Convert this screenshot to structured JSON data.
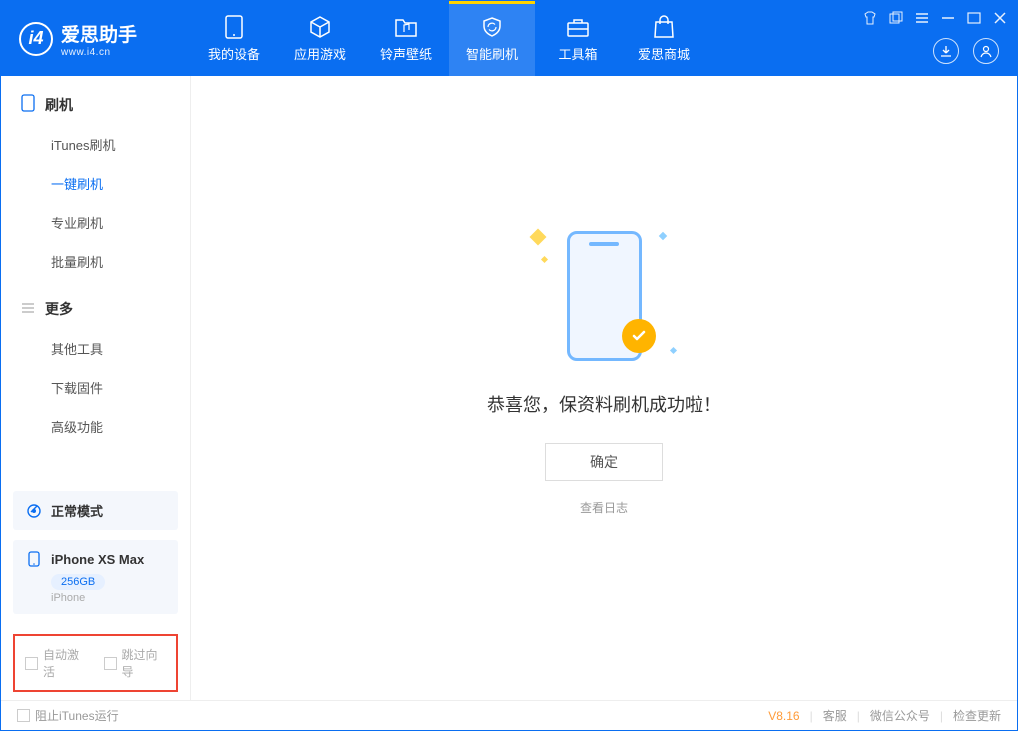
{
  "app": {
    "name": "爱思助手",
    "url": "www.i4.cn"
  },
  "nav": {
    "items": [
      {
        "label": "我的设备"
      },
      {
        "label": "应用游戏"
      },
      {
        "label": "铃声壁纸"
      },
      {
        "label": "智能刷机"
      },
      {
        "label": "工具箱"
      },
      {
        "label": "爱思商城"
      }
    ]
  },
  "sidebar": {
    "section1": {
      "title": "刷机"
    },
    "items1": [
      {
        "label": "iTunes刷机"
      },
      {
        "label": "一键刷机"
      },
      {
        "label": "专业刷机"
      },
      {
        "label": "批量刷机"
      }
    ],
    "section2": {
      "title": "更多"
    },
    "items2": [
      {
        "label": "其他工具"
      },
      {
        "label": "下载固件"
      },
      {
        "label": "高级功能"
      }
    ]
  },
  "device": {
    "mode": "正常模式",
    "name": "iPhone XS Max",
    "storage": "256GB",
    "type": "iPhone"
  },
  "options": {
    "auto_activate": "自动激活",
    "skip_guide": "跳过向导"
  },
  "main": {
    "success_msg": "恭喜您，保资料刷机成功啦！",
    "ok": "确定",
    "view_log": "查看日志"
  },
  "footer": {
    "block_itunes": "阻止iTunes运行",
    "version": "V8.16",
    "links": [
      "客服",
      "微信公众号",
      "检查更新"
    ]
  }
}
